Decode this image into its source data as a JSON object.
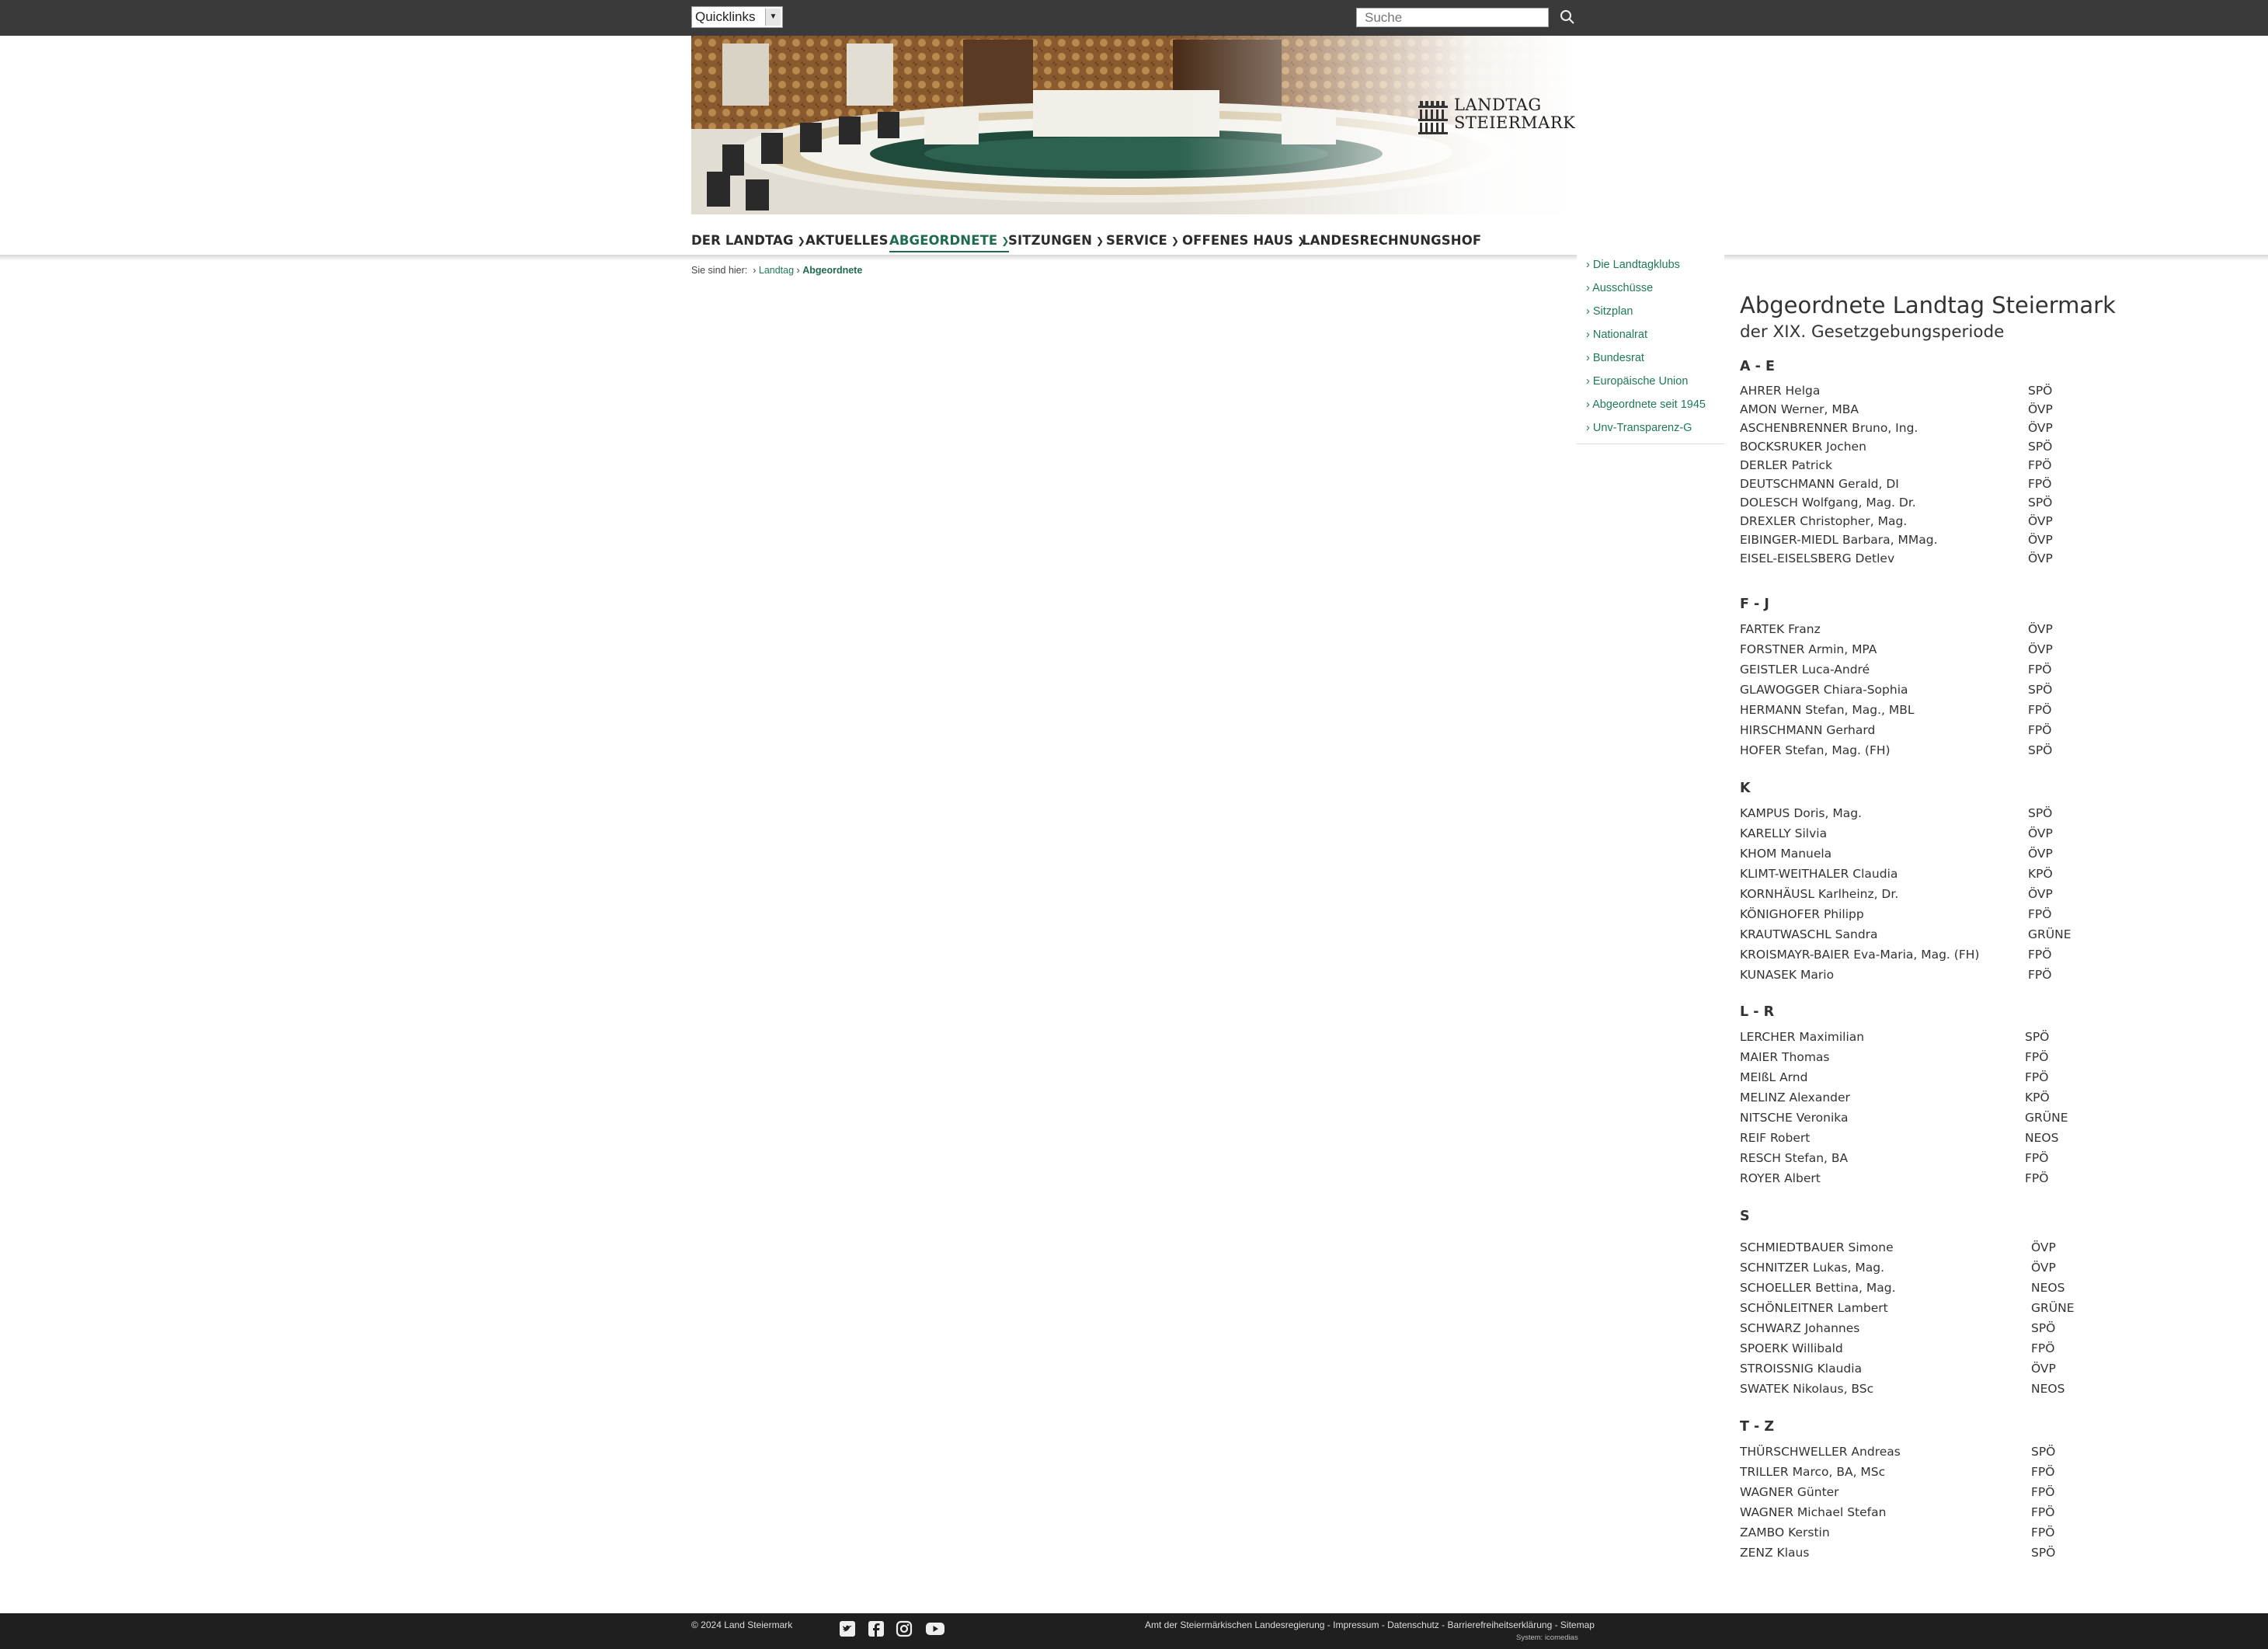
{
  "topbar": {
    "quicklinks_label": "Quicklinks",
    "search_placeholder": "Suche"
  },
  "header": {
    "logo_line1": "LANDTAG",
    "logo_line2": "STEIERMARK"
  },
  "nav": {
    "items": [
      {
        "label": "DER LANDTAG",
        "has_dropdown": true
      },
      {
        "label": "AKTUELLES",
        "has_dropdown": false
      },
      {
        "label": "ABGEORDNETE",
        "has_dropdown": true,
        "active": true
      },
      {
        "label": "SITZUNGEN",
        "has_dropdown": true
      },
      {
        "label": "SERVICE",
        "has_dropdown": true
      },
      {
        "label": "OFFENES HAUS",
        "has_dropdown": true
      },
      {
        "label": "LANDESRECHNUNGSHOF",
        "has_dropdown": false
      }
    ]
  },
  "breadcrumb": {
    "prefix": "Sie sind hier:",
    "items": [
      "Landtag",
      "Abgeordnete"
    ]
  },
  "subnav": {
    "items": [
      "Die Landtagklubs",
      "Ausschüsse",
      "Sitzplan",
      "Nationalrat",
      "Bundesrat",
      "Europäische Union",
      "Abgeordnete seit 1945",
      "Unv-Transparenz-G"
    ]
  },
  "content": {
    "title": "Abgeordnete Landtag Steiermark",
    "subtitle": "der XIX. Gesetzgebungsperiode",
    "groups": [
      {
        "heading": "A - E",
        "members": [
          {
            "name": "AHRER Helga",
            "party": "SPÖ"
          },
          {
            "name": "AMON Werner, MBA",
            "party": "ÖVP"
          },
          {
            "name": "ASCHENBRENNER Bruno, Ing.",
            "party": "ÖVP"
          },
          {
            "name": "BOCKSRUKER Jochen",
            "party": "SPÖ"
          },
          {
            "name": "DERLER Patrick",
            "party": "FPÖ"
          },
          {
            "name": "DEUTSCHMANN Gerald, DI",
            "party": "FPÖ"
          },
          {
            "name": "DOLESCH Wolfgang, Mag. Dr.",
            "party": "SPÖ"
          },
          {
            "name": "DREXLER Christopher, Mag.",
            "party": "ÖVP"
          },
          {
            "name": "EIBINGER-MIEDL Barbara, MMag.",
            "party": "ÖVP"
          },
          {
            "name": "EISEL-EISELSBERG Detlev",
            "party": "ÖVP"
          }
        ]
      },
      {
        "heading": "F - J",
        "members": [
          {
            "name": "FARTEK Franz",
            "party": "ÖVP"
          },
          {
            "name": "FORSTNER Armin, MPA",
            "party": "ÖVP"
          },
          {
            "name": "GEISTLER Luca-André",
            "party": "FPÖ"
          },
          {
            "name": "GLAWOGGER Chiara-Sophia",
            "party": "SPÖ"
          },
          {
            "name": "HERMANN Stefan, Mag., MBL",
            "party": "FPÖ"
          },
          {
            "name": "HIRSCHMANN Gerhard",
            "party": "FPÖ"
          },
          {
            "name": "HOFER Stefan, Mag. (FH)",
            "party": "SPÖ"
          }
        ]
      },
      {
        "heading": "K",
        "members": [
          {
            "name": "KAMPUS Doris, Mag.",
            "party": "SPÖ"
          },
          {
            "name": "KARELLY Silvia",
            "party": "ÖVP"
          },
          {
            "name": "KHOM Manuela",
            "party": "ÖVP"
          },
          {
            "name": "KLIMT-WEITHALER Claudia",
            "party": "KPÖ"
          },
          {
            "name": "KORNHÄUSL Karlheinz, Dr.",
            "party": "ÖVP"
          },
          {
            "name": "KÖNIGHOFER Philipp",
            "party": "FPÖ"
          },
          {
            "name": "KRAUTWASCHL Sandra",
            "party": "GRÜNE"
          },
          {
            "name": "KROISMAYR-BAIER Eva-Maria, Mag. (FH)",
            "party": "FPÖ"
          },
          {
            "name": "KUNASEK Mario",
            "party": "FPÖ"
          }
        ]
      },
      {
        "heading": "L - R",
        "members": [
          {
            "name": "LERCHER Maximilian",
            "party": "SPÖ"
          },
          {
            "name": "MAIER Thomas",
            "party": "FPÖ"
          },
          {
            "name": "MEIßL Arnd",
            "party": "FPÖ"
          },
          {
            "name": "MELINZ Alexander",
            "party": "KPÖ"
          },
          {
            "name": "NITSCHE Veronika",
            "party": "GRÜNE"
          },
          {
            "name": "REIF Robert",
            "party": "NEOS"
          },
          {
            "name": "RESCH Stefan, BA",
            "party": "FPÖ"
          },
          {
            "name": "ROYER Albert",
            "party": "FPÖ"
          }
        ]
      },
      {
        "heading": "S",
        "members": [
          {
            "name": "SCHMIEDTBAUER Simone",
            "party": "ÖVP"
          },
          {
            "name": "SCHNITZER Lukas, Mag.",
            "party": "ÖVP"
          },
          {
            "name": "SCHOELLER Bettina, Mag.",
            "party": "NEOS"
          },
          {
            "name": "SCHÖNLEITNER Lambert",
            "party": "GRÜNE"
          },
          {
            "name": "SCHWARZ Johannes",
            "party": "SPÖ"
          },
          {
            "name": "SPOERK Willibald",
            "party": "FPÖ"
          },
          {
            "name": "STROISSNIG Klaudia",
            "party": "ÖVP"
          },
          {
            "name": "SWATEK Nikolaus, BSc",
            "party": "NEOS"
          }
        ]
      },
      {
        "heading": "T - Z",
        "members": [
          {
            "name": "THÜRSCHWELLER Andreas",
            "party": "SPÖ"
          },
          {
            "name": "TRILLER Marco, BA, MSc",
            "party": "FPÖ"
          },
          {
            "name": "WAGNER Günter",
            "party": "FPÖ"
          },
          {
            "name": "WAGNER Michael Stefan",
            "party": "FPÖ"
          },
          {
            "name": "ZAMBO Kerstin",
            "party": "FPÖ"
          },
          {
            "name": "ZENZ Klaus",
            "party": "SPÖ"
          }
        ]
      }
    ]
  },
  "footer": {
    "copyright": "© 2024 Land Steiermark",
    "links": [
      "Amt der Steiermärkischen Landesregierung",
      "Impressum",
      "Datenschutz",
      "Barrierefreiheitserklärung",
      "Sitemap"
    ],
    "system": "System: icomedias"
  },
  "icons": [
    "search-icon",
    "chevron-down-icon",
    "chevron-right-icon",
    "twitter-icon",
    "facebook-icon",
    "instagram-icon",
    "youtube-icon",
    "landtag-logo-icon"
  ],
  "colors": {
    "accent": "#1e6b4d",
    "topbar": "#3a3a3a",
    "footer": "#1f1f1f"
  }
}
